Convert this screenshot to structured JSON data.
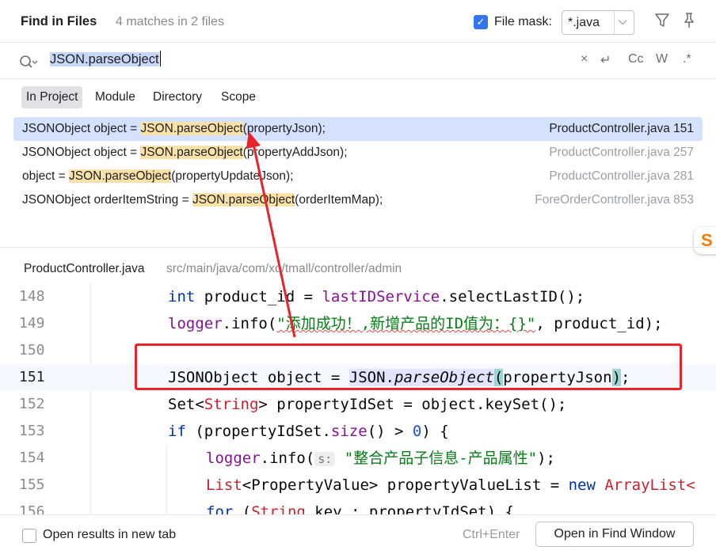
{
  "header": {
    "title": "Find in Files",
    "match_summary": "4 matches in 2 files",
    "file_mask_label": "File mask:",
    "file_mask_value": "*.java",
    "file_mask_checked": true
  },
  "search": {
    "query": "JSON.parseObject",
    "tools": [
      "×",
      "↵",
      "Cc",
      "W",
      ".*"
    ]
  },
  "scopes": [
    {
      "label": "In Project",
      "active": true
    },
    {
      "label": "Module",
      "active": false
    },
    {
      "label": "Directory",
      "active": false
    },
    {
      "label": "Scope",
      "active": false
    }
  ],
  "results": [
    {
      "before": "JSONObject object = ",
      "match": "JSON.parseObject",
      "after": "(propertyJson);",
      "file": "ProductController.java 151",
      "selected": true
    },
    {
      "before": "JSONObject object = ",
      "match": "JSON.parseObject",
      "after": "(propertyAddJson);",
      "file": "ProductController.java 257",
      "selected": false
    },
    {
      "before": "object = ",
      "match": "JSON.parseObject",
      "after": "(propertyUpdateJson);",
      "file": "ProductController.java 281",
      "selected": false
    },
    {
      "before": "JSONObject orderItemString = ",
      "match": "JSON.parseObject",
      "after": "(orderItemMap);",
      "file": "ForeOrderController.java 853",
      "selected": false
    }
  ],
  "preview": {
    "file_name": "ProductController.java",
    "path": "src/main/java/com/xq/tmall/controller/admin",
    "line_numbers": [
      "148",
      "149",
      "150",
      "151",
      "152",
      "153",
      "154",
      "155",
      "156"
    ],
    "lines": {
      "l148": {
        "kw": "int",
        "a": " product_id = ",
        "fld": "lastIDService",
        "b": ".selectLastID();"
      },
      "l149": {
        "fld": "logger",
        "a": ".info(",
        "str": "\"添加成功！,新增产品的ID值为：{}\"",
        "b": ", product_id);"
      },
      "l151": {
        "a": "JSONObject object = ",
        "cls": "JSON",
        "b": ".",
        "fn": "parseObject",
        "p1": "(",
        "arg": "propertyJson",
        "p2": ")",
        "c": ";"
      },
      "l152": {
        "a": "Set<",
        "cls": "String",
        "b": "> propertyIdSet = object.keySet();"
      },
      "l153": {
        "kw": "if",
        "a": " (propertyIdSet.",
        "fn": "size",
        "b": "() > ",
        "num": "0",
        "c": ") {"
      },
      "l154": {
        "fld": "logger",
        "a": ".info(",
        "hint": "s:",
        "str": " \"整合产品子信息-产品属性\"",
        "b": ");"
      },
      "l155": {
        "cls": "List",
        "a": "<PropertyValue> propertyValueList = ",
        "kw": "new",
        "cls2": " ArrayList<"
      },
      "l156": {
        "kw": "for",
        "a": " (",
        "cls": "String",
        "b": " key : propertyIdSet) {"
      }
    }
  },
  "footer": {
    "open_new_tab_label": "Open results in new tab",
    "shortcut": "Ctrl+Enter",
    "open_button": "Open in Find Window"
  },
  "colors": {
    "accent": "#3574f0",
    "selected_row": "#d4e2ff",
    "match_highlight": "#f9e1a8",
    "annotation_red": "#e8242b"
  }
}
